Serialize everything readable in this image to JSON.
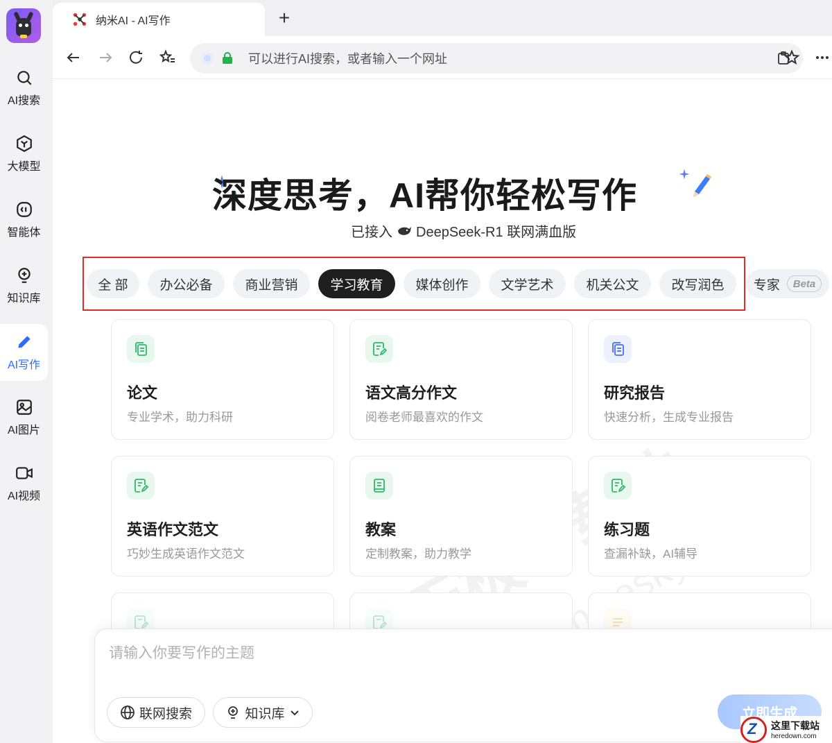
{
  "sidebar": {
    "items": [
      {
        "label": "AI搜索",
        "icon": "search-icon"
      },
      {
        "label": "大模型",
        "icon": "model-cube-icon"
      },
      {
        "label": "智能体",
        "icon": "agent-icon"
      },
      {
        "label": "知识库",
        "icon": "lightbulb-icon"
      },
      {
        "label": "AI写作",
        "icon": "pencil-icon",
        "active": true
      },
      {
        "label": "AI图片",
        "icon": "image-icon"
      },
      {
        "label": "AI视频",
        "icon": "video-icon"
      }
    ]
  },
  "browser": {
    "tab_title": "纳米AI - AI写作",
    "address_placeholder": "可以进行AI搜索，或者输入一个网址"
  },
  "hero": {
    "title": "深度思考，AI帮你轻松写作",
    "subtitle_prefix": "已接入",
    "subtitle_model": "DeepSeek-R1 联网满血版"
  },
  "categories": [
    {
      "label": "全 部"
    },
    {
      "label": "办公必备"
    },
    {
      "label": "商业营销"
    },
    {
      "label": "学习教育",
      "active": true
    },
    {
      "label": "媒体创作"
    },
    {
      "label": "文学艺术"
    },
    {
      "label": "机关公文"
    },
    {
      "label": "改写润色"
    },
    {
      "label": "专家",
      "badge": "Beta"
    }
  ],
  "cards": [
    {
      "title": "论文",
      "desc": "专业学术，助力科研",
      "icon": "document-copy-icon"
    },
    {
      "title": "语文高分作文",
      "desc": "阅卷老师最喜欢的作文",
      "icon": "edit-note-icon"
    },
    {
      "title": "研究报告",
      "desc": "快速分析，生成专业报告",
      "icon": "report-copy-icon"
    },
    {
      "title": "英语作文范文",
      "desc": "巧妙生成英语作文范文",
      "icon": "edit-note-icon"
    },
    {
      "title": "教案",
      "desc": "定制教案，助力教学",
      "icon": "book-icon"
    },
    {
      "title": "练习题",
      "desc": "查漏补缺，AI辅导",
      "icon": "edit-note-icon"
    }
  ],
  "input": {
    "placeholder": "请输入你要写作的主题",
    "web_search_label": "联网搜索",
    "knowledge_label": "知识库",
    "generate_label": "立即生成"
  },
  "watermark": {
    "cn": "天极下载站",
    "en": "mydown.yesky.com"
  },
  "corner_badge": {
    "cn": "这里下载站",
    "en": "heredown.com"
  },
  "colors": {
    "accent": "#2f6bff",
    "highlight_border": "#e02b2b",
    "active_chip": "#1f1f1f"
  }
}
